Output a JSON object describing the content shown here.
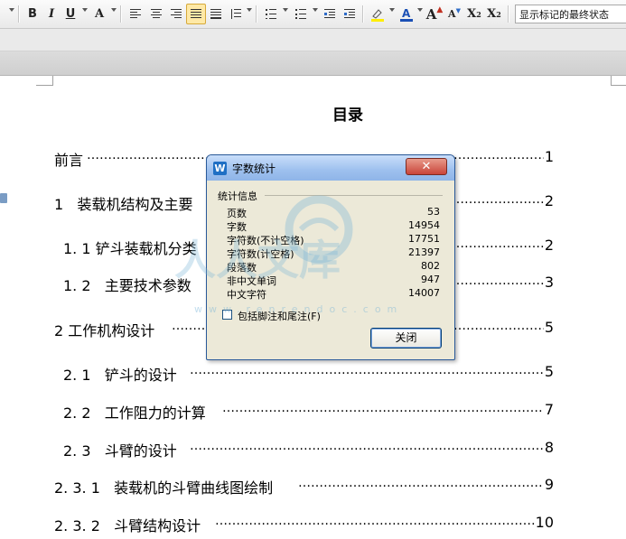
{
  "toolbar": {
    "bold": "B",
    "italic": "I",
    "underline": "U",
    "font_color_a": "A",
    "grow_font": "A",
    "shrink_font": "A",
    "superscript": "X",
    "superscript_mark": "2",
    "subscript": "X",
    "subscript_mark": "2",
    "markup_mode": "显示标记的最终状态"
  },
  "document": {
    "toc_title": "目录",
    "entries": [
      {
        "text": "前言",
        "page": "1"
      },
      {
        "text": "1   装载机结构及主要",
        "page": "2"
      },
      {
        "text": "1. 1 铲斗装载机分类",
        "page": "2"
      },
      {
        "text": "1. 2   主要技术参数",
        "page": "3"
      },
      {
        "text": "2 工作机构设计",
        "page": "5"
      },
      {
        "text": "2. 1   铲斗的设计",
        "page": "5"
      },
      {
        "text": "2. 2   工作阻力的计算",
        "page": "7"
      },
      {
        "text": "2. 3   斗臂的设计",
        "page": "8"
      },
      {
        "text": "2. 3. 1   装载机的斗臂曲线图绘制",
        "page": "9"
      },
      {
        "text": "2. 3. 2   斗臂结构设计",
        "page": "10"
      }
    ]
  },
  "dialog": {
    "logo": "W",
    "title": "字数统计",
    "close_x": "✕",
    "group_label": "统计信息",
    "stats": [
      {
        "label": "页数",
        "value": "53"
      },
      {
        "label": "字数",
        "value": "14954"
      },
      {
        "label": "字符数(不计空格)",
        "value": "17751"
      },
      {
        "label": "字符数(计空格)",
        "value": "21397"
      },
      {
        "label": "段落数",
        "value": "802"
      },
      {
        "label": "非中文单词",
        "value": "947"
      },
      {
        "label": "中文字符",
        "value": "14007"
      }
    ],
    "include_footnotes_label": "包括脚注和尾注(F)",
    "include_footnotes_checked": false,
    "close_button": "关闭"
  },
  "watermark": {
    "chars": "人人文库",
    "url": "www.renrendoc.com"
  }
}
